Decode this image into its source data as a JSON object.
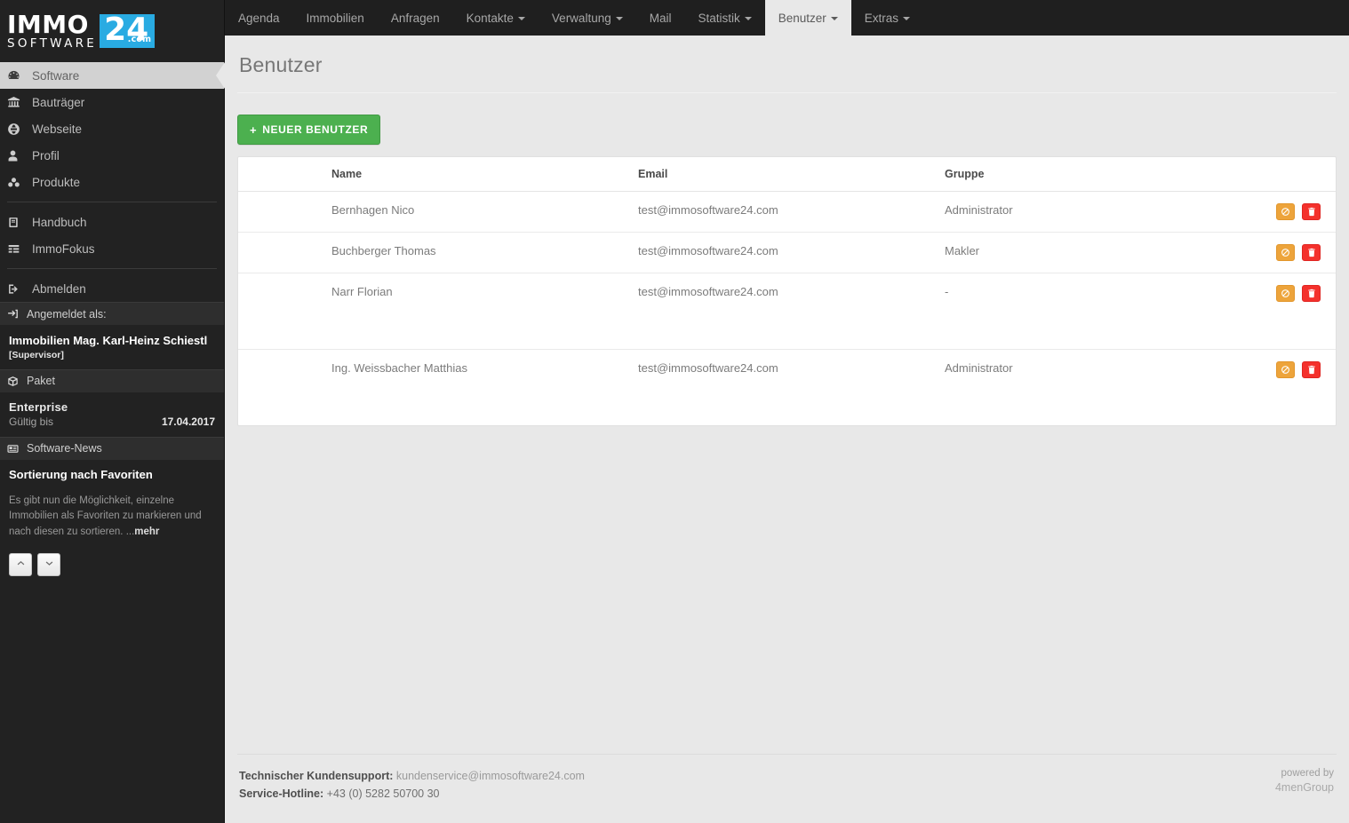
{
  "brand": {
    "immo": "IMMO",
    "software": "SOFTWARE",
    "badge": "24",
    "dotcom": ".com"
  },
  "topnav": {
    "items": [
      {
        "label": "Agenda",
        "caret": false,
        "active": false
      },
      {
        "label": "Immobilien",
        "caret": false,
        "active": false
      },
      {
        "label": "Anfragen",
        "caret": false,
        "active": false
      },
      {
        "label": "Kontakte",
        "caret": true,
        "active": false
      },
      {
        "label": "Verwaltung",
        "caret": true,
        "active": false
      },
      {
        "label": "Mail",
        "caret": false,
        "active": false
      },
      {
        "label": "Statistik",
        "caret": true,
        "active": false
      },
      {
        "label": "Benutzer",
        "caret": true,
        "active": true
      },
      {
        "label": "Extras",
        "caret": true,
        "active": false
      }
    ]
  },
  "sidebar": {
    "nav_group_1": [
      {
        "label": "Software",
        "icon": "dashboard-icon",
        "active": true
      },
      {
        "label": "Bauträger",
        "icon": "bank-icon",
        "active": false
      },
      {
        "label": "Webseite",
        "icon": "globe-icon",
        "active": false
      },
      {
        "label": "Profil",
        "icon": "user-icon",
        "active": false
      },
      {
        "label": "Produkte",
        "icon": "cubes-icon",
        "active": false
      }
    ],
    "nav_group_2": [
      {
        "label": "Handbuch",
        "icon": "book-icon",
        "active": false
      },
      {
        "label": "ImmoFokus",
        "icon": "list-icon",
        "active": false
      }
    ],
    "nav_group_3": [
      {
        "label": "Abmelden",
        "icon": "logout-icon",
        "active": false
      }
    ],
    "account": {
      "header": "Angemeldet als:",
      "header_icon": "sign-in-icon",
      "name": "Immobilien Mag. Karl-Heinz Schiestl",
      "role": "[Supervisor]"
    },
    "paket": {
      "header": "Paket",
      "header_icon": "box-icon",
      "name": "Enterprise",
      "valid_label": "Gültig bis",
      "valid_date": "17.04.2017"
    },
    "news": {
      "header": "Software-News",
      "header_icon": "newspaper-icon",
      "title": "Sortierung nach Favoriten",
      "text": "Es gibt nun die Möglichkeit, einzelne Immobilien als Favoriten zu markieren und nach diesen zu sortieren. ...",
      "more_label": "mehr",
      "prev_icon": "chevron-up-icon",
      "next_icon": "chevron-down-icon"
    }
  },
  "page": {
    "title": "Benutzer",
    "new_button": {
      "label": "NEUER BENUTZER",
      "icon": "plus-icon"
    }
  },
  "table": {
    "headers": [
      "",
      "Name",
      "Email",
      "Gruppe",
      ""
    ],
    "rows": [
      {
        "name": "Bernhagen Nico",
        "email": "test@immosoftware24.com",
        "gruppe": "Administrator",
        "tall": false
      },
      {
        "name": "Buchberger Thomas",
        "email": "test@immosoftware24.com",
        "gruppe": "Makler",
        "tall": false
      },
      {
        "name": "Narr Florian",
        "email": "test@immosoftware24.com",
        "gruppe": "-",
        "tall": true
      },
      {
        "name": "Ing. Weissbacher Matthias",
        "email": "test@immosoftware24.com",
        "gruppe": "Administrator",
        "tall": true
      }
    ],
    "actions": {
      "ban_icon": "ban-icon",
      "delete_icon": "trash-icon"
    }
  },
  "footer": {
    "support_label": "Technischer Kundensupport:",
    "support_email": "kundenservice@immosoftware24.com",
    "hotline_label": "Service-Hotline:",
    "hotline_value": "+43 (0) 5282 50700 30",
    "powered_by": "powered by",
    "brand": "4menGroup"
  },
  "colors": {
    "accent_blue": "#29abe2",
    "green": "#4cb04f",
    "orange": "#eda43b",
    "red": "#f4312c",
    "sidebar_bg": "#222222",
    "topnav_bg": "#1f1f1f",
    "content_bg": "#e8e8e8"
  }
}
